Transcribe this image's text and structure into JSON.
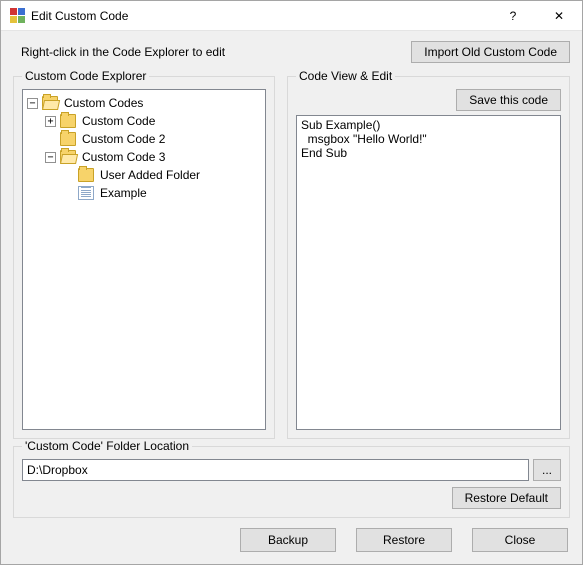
{
  "window": {
    "title": "Edit Custom Code",
    "help_symbol": "?",
    "close_symbol": "✕"
  },
  "instruction": "Right-click in the Code Explorer to edit",
  "buttons": {
    "import_old": "Import Old Custom Code",
    "save_code": "Save this code",
    "browse": "...",
    "restore_default": "Restore Default",
    "backup": "Backup",
    "restore": "Restore",
    "close": "Close"
  },
  "groups": {
    "explorer": "Custom Code Explorer",
    "code_view": "Code View & Edit",
    "folder_location": "'Custom Code' Folder Location"
  },
  "tree": {
    "root": "Custom Codes",
    "n1": "Custom Code",
    "n2": "Custom Code 2",
    "n3": "Custom Code 3",
    "n3a": "User Added Folder",
    "n3b": "Example"
  },
  "code_text": "Sub Example()\n  msgbox \"Hello World!\"\nEnd Sub",
  "folder_path": "D:\\Dropbox"
}
